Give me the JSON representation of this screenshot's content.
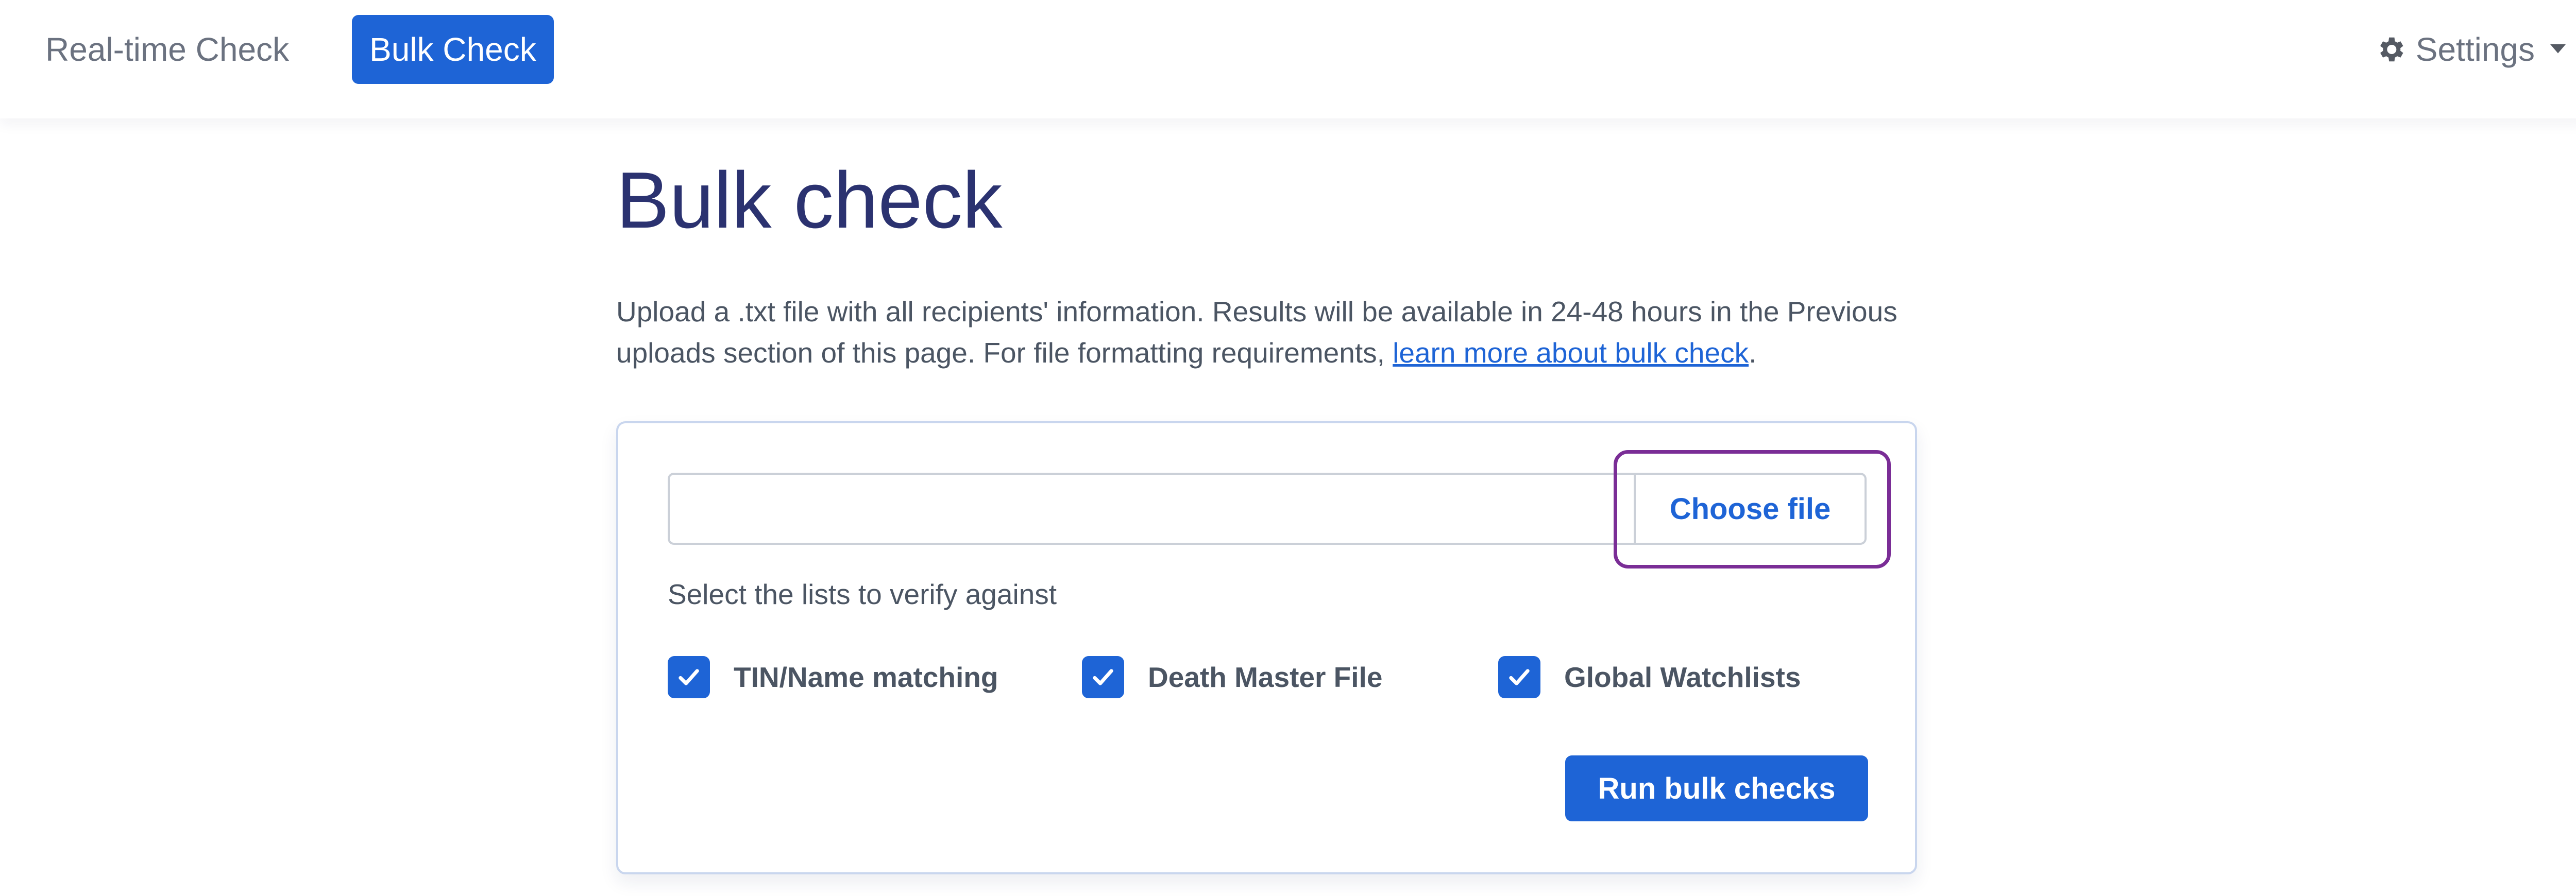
{
  "nav": {
    "realtime_label": "Real-time Check",
    "bulk_label": "Bulk Check",
    "settings_label": "Settings",
    "settings_icon": "gear-icon",
    "settings_caret_icon": "caret-down-icon"
  },
  "page": {
    "title": "Bulk check",
    "intro_text": "Upload a .txt file with all recipients' information. Results will be available in 24-48 hours in the Previous uploads section of this page. For file formatting requirements, ",
    "intro_link": "learn more about bulk check",
    "intro_end": "."
  },
  "upload": {
    "file_value": "",
    "choose_label": "Choose file",
    "lists_label": "Select the lists to verify against",
    "checks": [
      {
        "label": "TIN/Name matching",
        "checked": true
      },
      {
        "label": "Death Master File",
        "checked": true
      },
      {
        "label": "Global Watchlists",
        "checked": true
      }
    ],
    "run_label": "Run bulk checks"
  },
  "colors": {
    "accent": "#1e64d6",
    "title": "#2b3270",
    "focus_ring": "#7a2d96",
    "text": "#4b5563"
  }
}
